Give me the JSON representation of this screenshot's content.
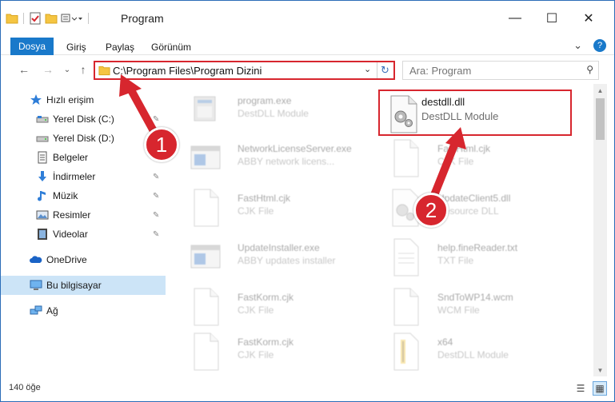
{
  "window": {
    "title": "Program",
    "minimize_glyph": "—",
    "maximize_glyph": "☐",
    "close_glyph": "✕"
  },
  "ribbon": {
    "tabs": [
      "Dosya",
      "Giriş",
      "Paylaş",
      "Görünüm"
    ],
    "expand_glyph": "⌄",
    "help_glyph": "?"
  },
  "nav": {
    "back_glyph": "←",
    "forward_glyph": "→",
    "recent_glyph": "⌄",
    "up_glyph": "↑"
  },
  "address": {
    "path": "C:\\Program Files\\Program Dizini",
    "dropdown_glyph": "⌄",
    "refresh_glyph": "↻"
  },
  "search": {
    "placeholder": "Ara: Program",
    "icon_glyph": "⚲"
  },
  "sidebar": {
    "items": [
      {
        "label": "Hızlı erişim",
        "icon": "star-icon",
        "pinned": false
      },
      {
        "label": "Yerel Disk (C:)",
        "icon": "drive-icon",
        "pinned": true
      },
      {
        "label": "Yerel Disk (D:)",
        "icon": "drive-icon",
        "pinned": false
      },
      {
        "label": "Belgeler",
        "icon": "documents-icon",
        "pinned": true
      },
      {
        "label": "İndirmeler",
        "icon": "download-icon",
        "pinned": true
      },
      {
        "label": "Müzik",
        "icon": "music-icon",
        "pinned": true
      },
      {
        "label": "Resimler",
        "icon": "pictures-icon",
        "pinned": true
      },
      {
        "label": "Videolar",
        "icon": "videos-icon",
        "pinned": true
      },
      {
        "label": "OneDrive",
        "icon": "cloud-icon",
        "pinned": false
      },
      {
        "label": "Bu bilgisayar",
        "icon": "computer-icon",
        "pinned": false,
        "selected": true
      },
      {
        "label": "Ağ",
        "icon": "network-icon",
        "pinned": false
      }
    ],
    "pin_glyph": "📌"
  },
  "files": [
    {
      "name": "program.exe",
      "desc": "DestDLL Module",
      "icon": "exe-icon"
    },
    {
      "name": "destdll.dll",
      "desc": "DestDLL Module",
      "icon": "dll-gear-icon",
      "highlighted": true
    },
    {
      "name": "NetworkLicenseServer.exe",
      "desc": "ABBY network licens...",
      "icon": "app-window-icon"
    },
    {
      "name": "FastHtml.cjk",
      "desc": "CJK File",
      "icon": "blank-file-icon"
    },
    {
      "name": "FastHtml.cjk",
      "desc": "CJK File",
      "icon": "blank-file-icon"
    },
    {
      "name": "UpdateClient5.dll",
      "desc": "Resource DLL",
      "icon": "dll-gear-icon"
    },
    {
      "name": "UpdateInstaller.exe",
      "desc": "ABBY updates installer",
      "icon": "app-window-icon"
    },
    {
      "name": "help.fineReader.txt",
      "desc": "TXT File",
      "icon": "text-file-icon"
    },
    {
      "name": "FastKorm.cjk",
      "desc": "CJK File",
      "icon": "blank-file-icon"
    },
    {
      "name": "SndToWP14.wcm",
      "desc": "WCM File",
      "icon": "blank-file-icon"
    },
    {
      "name": "FastKorm.cjk",
      "desc": "CJK File",
      "icon": "blank-file-icon"
    },
    {
      "name": "x64",
      "desc": "DestDLL Module",
      "icon": "zip-folder-icon"
    }
  ],
  "status": {
    "count": "140 öğe",
    "details_view_glyph": "☰",
    "icons_view_glyph": "▦"
  },
  "annotations": {
    "step1": "1",
    "step2": "2"
  },
  "colors": {
    "accent": "#1979ca",
    "highlight_red": "#d7262e",
    "selected_bg": "#cce4f7",
    "folder_yellow": "#f5c542"
  }
}
